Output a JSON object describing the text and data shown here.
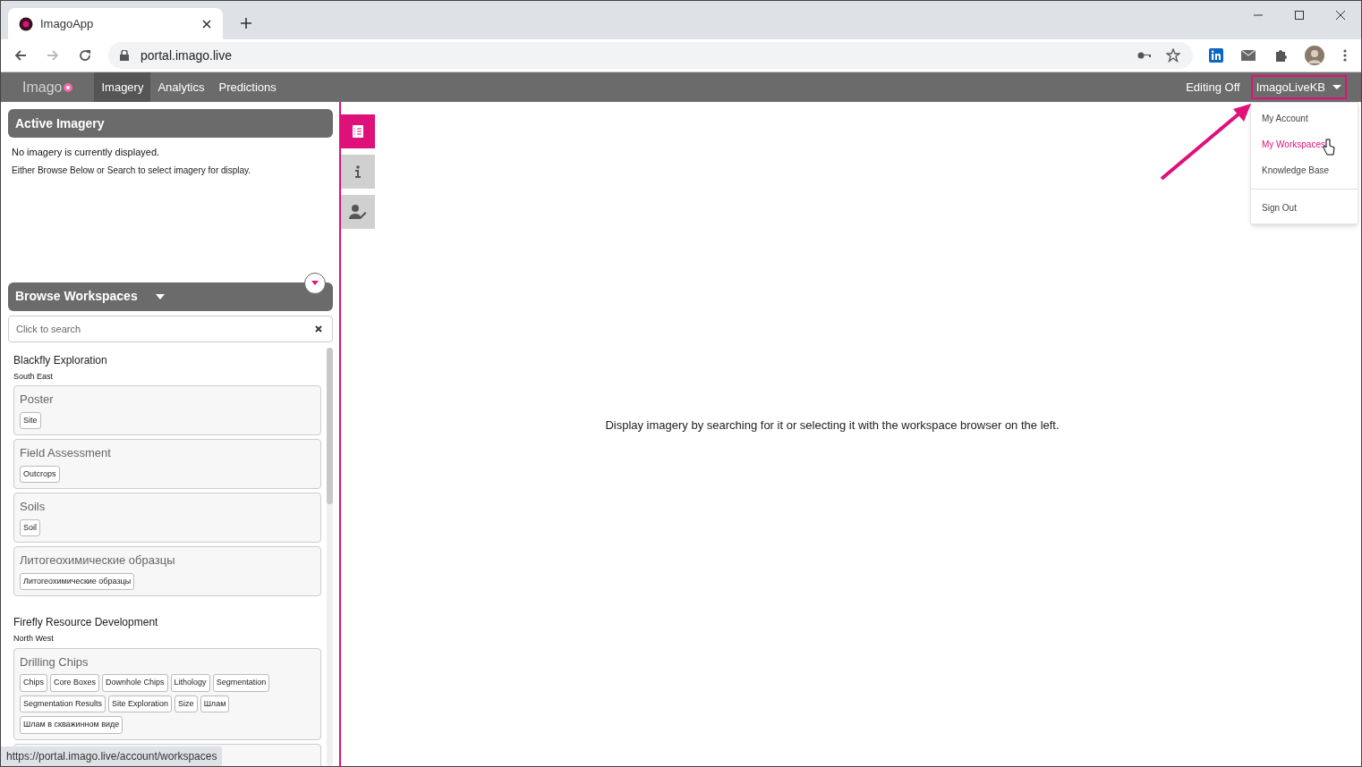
{
  "browser": {
    "tab": {
      "title": "ImagoApp"
    },
    "address": "portal.imago.live",
    "status_url": "https://portal.imago.live/account/workspaces"
  },
  "app_nav": {
    "logo": "Imago",
    "items": [
      {
        "label": "Imagery",
        "selected": true
      },
      {
        "label": "Analytics",
        "selected": false
      },
      {
        "label": "Predictions",
        "selected": false
      }
    ],
    "editing": "Editing Off",
    "user": "ImagoLiveKB",
    "user_menu": {
      "expanded": true,
      "items": [
        {
          "label": "My Account",
          "highlighted": false,
          "kind": "item"
        },
        {
          "label": "My Workspaces",
          "highlighted": true,
          "kind": "item"
        },
        {
          "label": "Knowledge Base",
          "highlighted": false,
          "kind": "item"
        },
        {
          "label": "Sign Out",
          "highlighted": false,
          "kind": "separated"
        }
      ]
    }
  },
  "active_imagery": {
    "title": "Active Imagery",
    "message": "No imagery is currently displayed.",
    "hint": "Either Browse Below or Search to select imagery for display."
  },
  "side_tabs": [
    {
      "kind": "list",
      "selected": true
    },
    {
      "kind": "info",
      "selected": false
    },
    {
      "kind": "user-edit",
      "selected": false
    }
  ],
  "browse": {
    "title": "Browse Workspaces",
    "search": {
      "placeholder": "Click to search"
    },
    "workspaces": [
      {
        "name": "Blackfly Exploration",
        "region": "South East",
        "collections": [
          {
            "name": "Poster",
            "tags": [
              "Site"
            ]
          },
          {
            "name": "Field Assessment",
            "tags": [
              "Outcrops"
            ]
          },
          {
            "name": "Soils",
            "tags": [
              "Soil"
            ]
          },
          {
            "name": "Литогеохимические образцы",
            "tags": [
              "Литогеохимические образцы"
            ]
          }
        ]
      },
      {
        "name": "Firefly Resource Development",
        "region": "North West",
        "collections": [
          {
            "name": "Drilling Chips",
            "tags": [
              "Chips",
              "Core Boxes",
              "Downhole Chips",
              "Lithology",
              "Segmentation",
              "Segmentation Results",
              "Site Exploration",
              "Size",
              "Шлам",
              "Шлам в скважинном виде"
            ]
          }
        ]
      }
    ]
  },
  "main": {
    "message": "Display imagery by searching for it or selecting it with the workspace browser on the left."
  }
}
